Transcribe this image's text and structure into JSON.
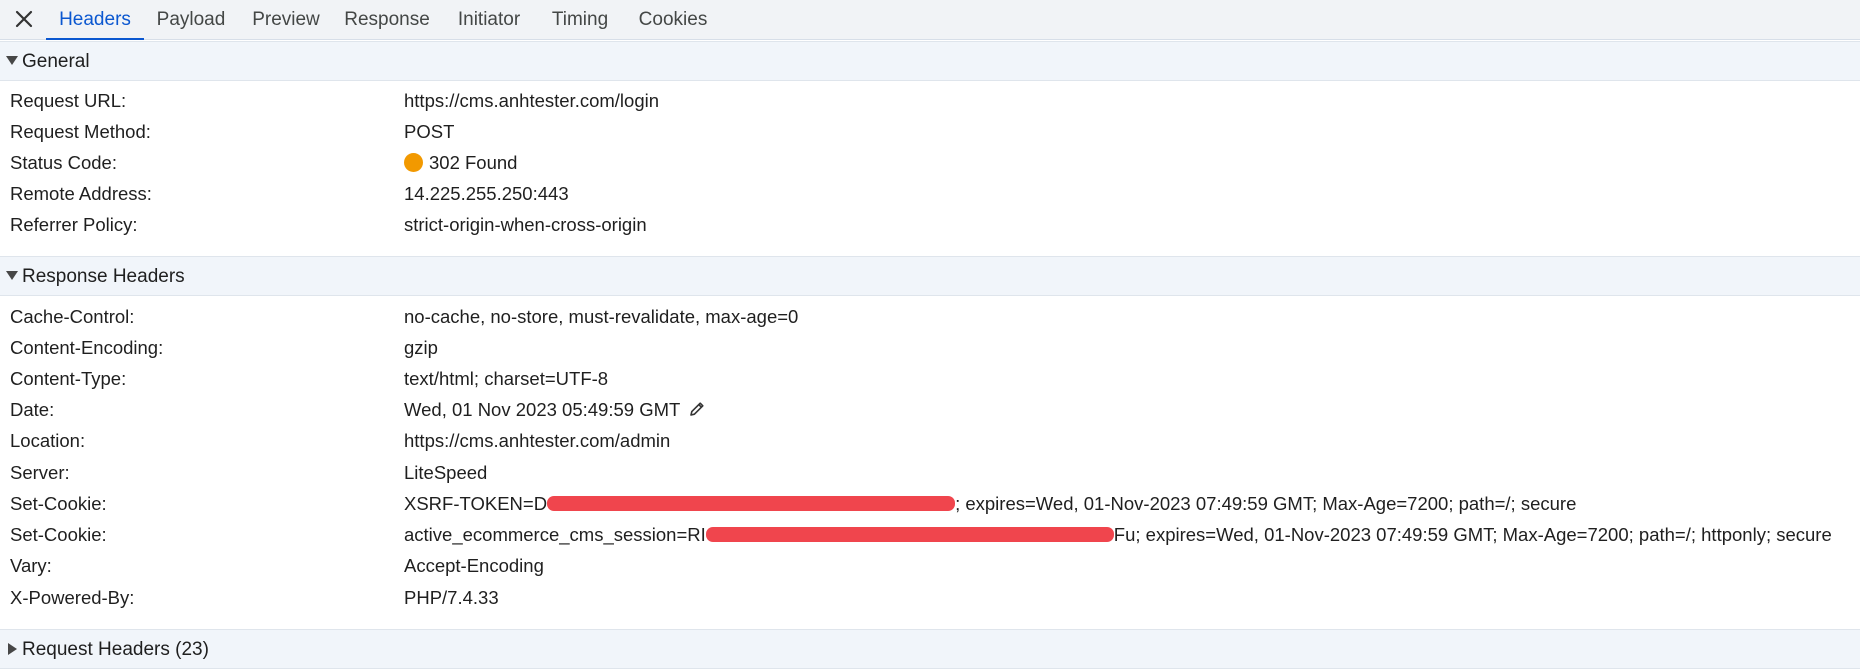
{
  "tabs": [
    {
      "label": "Headers",
      "active": true
    },
    {
      "label": "Payload",
      "active": false
    },
    {
      "label": "Preview",
      "active": false
    },
    {
      "label": "Response",
      "active": false
    },
    {
      "label": "Initiator",
      "active": false
    },
    {
      "label": "Timing",
      "active": false
    },
    {
      "label": "Cookies",
      "active": false
    }
  ],
  "general": {
    "title": "General",
    "rows": [
      {
        "key": "Request URL:",
        "value": "https://cms.anhtester.com/login"
      },
      {
        "key": "Request Method:",
        "value": "POST"
      },
      {
        "key": "Status Code:",
        "value": "302 Found"
      },
      {
        "key": "Remote Address:",
        "value": "14.225.255.250:443"
      },
      {
        "key": "Referrer Policy:",
        "value": "strict-origin-when-cross-origin"
      }
    ],
    "status_color": "#f29900"
  },
  "response_headers": {
    "title": "Response Headers",
    "rows": [
      {
        "key": "Cache-Control:",
        "value": "no-cache, no-store, must-revalidate, max-age=0"
      },
      {
        "key": "Content-Encoding:",
        "value": "gzip"
      },
      {
        "key": "Content-Type:",
        "value": "text/html; charset=UTF-8"
      },
      {
        "key": "Date:",
        "value": "Wed, 01 Nov 2023 05:49:59 GMT"
      },
      {
        "key": "Location:",
        "value": "https://cms.anhtester.com/admin"
      },
      {
        "key": "Server:",
        "value": "LiteSpeed"
      },
      {
        "key": "Set-Cookie:",
        "value_prefix": "XSRF-TOKEN=D",
        "value_suffix": "; expires=Wed, 01-Nov-2023 07:49:59 GMT; Max-Age=7200; path=/; secure"
      },
      {
        "key": "Set-Cookie:",
        "value_prefix": "active_ecommerce_cms_session=RI",
        "value_suffix": "Fu; expires=Wed, 01-Nov-2023 07:49:59 GMT; Max-Age=7200; path=/; httponly; secure"
      },
      {
        "key": "Vary:",
        "value": "Accept-Encoding"
      },
      {
        "key": "X-Powered-By:",
        "value": "PHP/7.4.33"
      }
    ],
    "redact_color": "#f0454d"
  },
  "request_headers": {
    "title": "Request Headers (23)"
  },
  "icons": {
    "close": "close-icon",
    "edit": "pencil-icon",
    "expanded": "triangle-down-icon",
    "collapsed": "triangle-right-icon"
  },
  "colors": {
    "accent": "#0b57d0",
    "tabbar_bg": "#f1f3f6",
    "section_bg": "#f1f5fa"
  }
}
